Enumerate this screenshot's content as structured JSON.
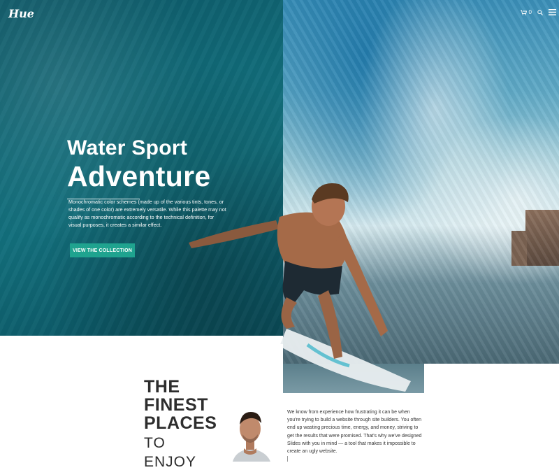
{
  "brand": {
    "logo": "Hue"
  },
  "nav": {
    "cart_count": "0"
  },
  "hero": {
    "title_line1": "Water Sport",
    "title_line2": "Adventure",
    "description": "Monochromatic color schemes (made up of the various tints, tones, or shades of one color) are extremely versatile. While this palette may not qualify as monochromatic according to the technical definition, for visual purposes, it creates a similar effect.",
    "cta_label": "VIEW THE COLLECTION"
  },
  "section": {
    "heading_lines": [
      "THE",
      "FINEST",
      "PLACES"
    ],
    "subheading_lines": [
      "TO",
      "ENJOY"
    ],
    "body": "We know from experience how frustrating it can be when you're trying to build a website through site builders. You often end up wasting precious time, energy, and money, striving to get the results that were promised. That's why we've designed Slides with you in mind — a tool that makes it impossible to create an ugly website."
  },
  "colors": {
    "teal_overlay": "#116a78",
    "cta": "#1fa38f",
    "heading": "#2d2d2d"
  },
  "icons": [
    "cart-icon",
    "search-icon",
    "hamburger-menu-icon"
  ]
}
